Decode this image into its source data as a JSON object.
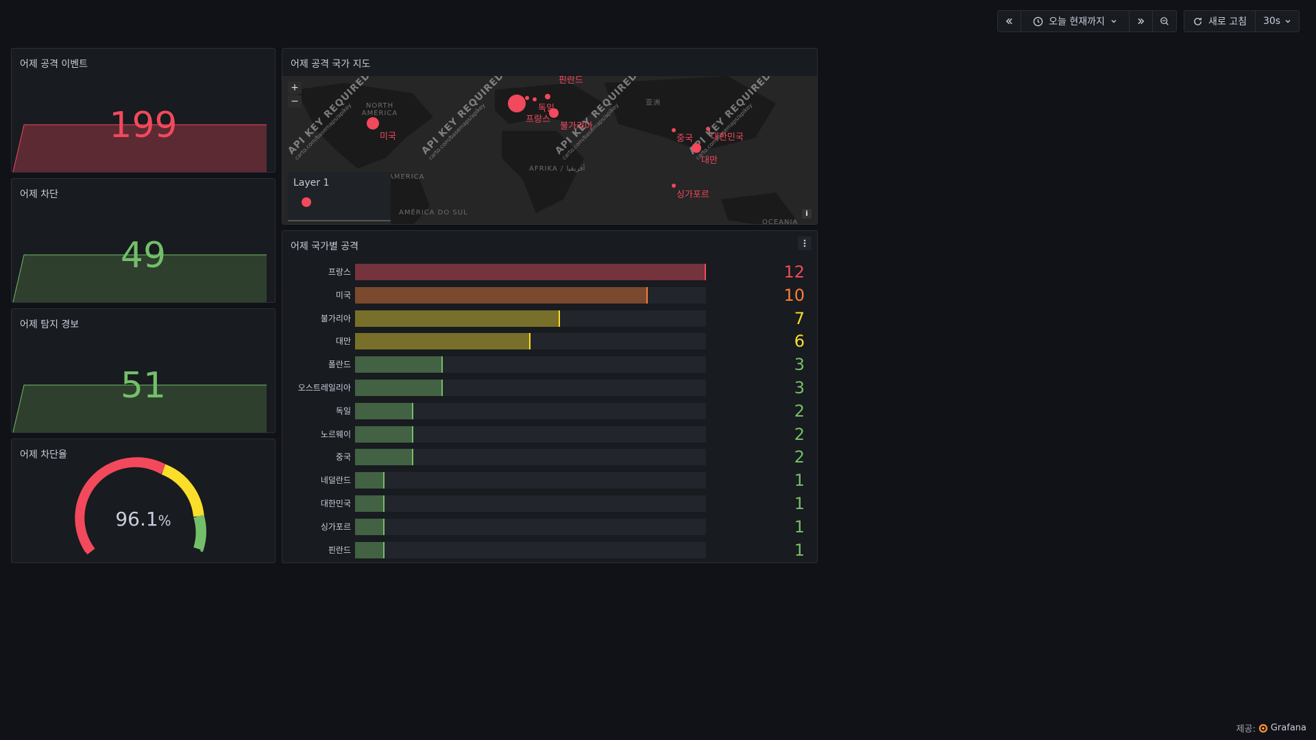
{
  "toolbar": {
    "time_range": "오늘 현재까지",
    "refresh_label": "새로 고침",
    "refresh_interval": "30s"
  },
  "panels": {
    "attack_events": {
      "title": "어제 공격 이벤트",
      "value": "199",
      "color": "#f2495c"
    },
    "blocked": {
      "title": "어제 차단",
      "value": "49",
      "color": "#73bf69"
    },
    "alerts": {
      "title": "어제 탐지 경보",
      "value": "51",
      "color": "#73bf69"
    },
    "block_rate": {
      "title": "어제 차단율",
      "value": "96.1",
      "unit": "%",
      "gauge_fraction": 0.961
    },
    "map": {
      "title": "어제 공격 국가 지도",
      "watermark": "API KEY REQUIRED",
      "watermark_sub": "carto.com/basemaps/apikey",
      "legend_title": "Layer 1",
      "zoom_in": "+",
      "zoom_out": "−",
      "info": "i",
      "point_labels": [
        "미국",
        "독일",
        "프랑스",
        "불가리아",
        "중국",
        "대한민국",
        "대만",
        "싱가포르",
        "핀란드"
      ],
      "geo_labels": [
        "NORTH AMERICA",
        "AMERICA",
        "AMÉRICA DO SUL",
        "AFRIKA / أفريقيا",
        "亚洲",
        "OCEANIA"
      ]
    },
    "country_attacks": {
      "title": "어제 국가별 공격",
      "menu_icon": "vertical-dots-icon"
    }
  },
  "chart_data": {
    "type": "bar",
    "orientation": "horizontal",
    "title": "어제 국가별 공격",
    "categories": [
      "프랑스",
      "미국",
      "불가리아",
      "대만",
      "폴란드",
      "오스트레일리아",
      "독일",
      "노르웨이",
      "중국",
      "네덜란드",
      "대한민국",
      "싱가포르",
      "핀란드"
    ],
    "values": [
      12,
      10,
      7,
      6,
      3,
      3,
      2,
      2,
      2,
      1,
      1,
      1,
      1
    ],
    "xlim": [
      0,
      12
    ],
    "colors": [
      "#f2495c",
      "#ff7f35",
      "#fade2a",
      "#fade2a",
      "#73bf69",
      "#73bf69",
      "#73bf69",
      "#73bf69",
      "#73bf69",
      "#73bf69",
      "#73bf69",
      "#73bf69",
      "#73bf69"
    ]
  },
  "footer": {
    "credit_prefix": "제공:",
    "credit_brand": "Grafana"
  }
}
